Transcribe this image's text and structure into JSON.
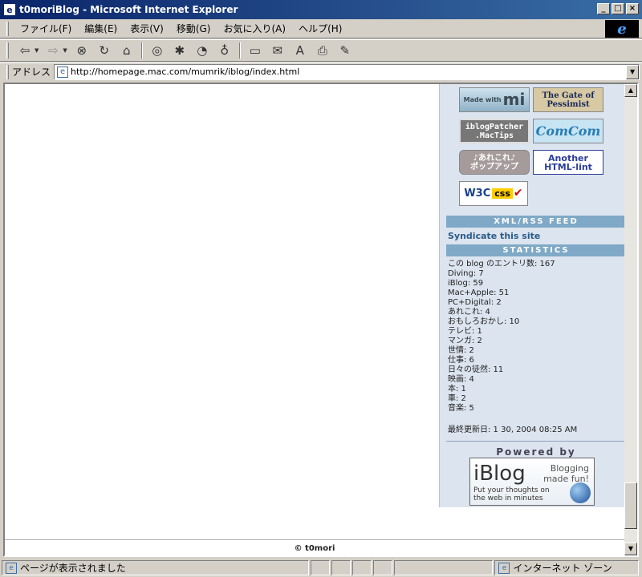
{
  "window": {
    "title": "t0moriBlog - Microsoft Internet Explorer",
    "app_icon": "ie-page-icon",
    "controls": {
      "minimize": "_",
      "maximize": "□",
      "close": "×"
    }
  },
  "menu": {
    "items": [
      "ファイル(F)",
      "編集(E)",
      "表示(V)",
      "移動(G)",
      "お気に入り(A)",
      "ヘルプ(H)"
    ]
  },
  "toolbar": {
    "icons": [
      "back-icon",
      "forward-icon",
      "stop-icon",
      "refresh-icon",
      "home-icon",
      "search-icon",
      "favorites-icon",
      "history-icon",
      "channels-icon",
      "fullscreen-icon",
      "mail-icon",
      "font-icon",
      "print-icon",
      "edit-icon"
    ]
  },
  "address": {
    "label": "アドレス",
    "url": "http://homepage.mac.com/mumrik/iblog/index.html"
  },
  "sidebar": {
    "badges": {
      "mi": "mi",
      "mi_caption": "Made with",
      "pessimist": "The Gate of Pessimist",
      "iblogpatcher_line1": "iblogPatcher",
      "iblogpatcher_line2": ".MacTips",
      "comcom": "ComCom",
      "popup_line1": "♪あれこれ♪",
      "popup_line2": "ポップアップ",
      "htmllint_line1": "Another",
      "htmllint_line2": "HTML-lint",
      "w3c": "W3C",
      "css": "css"
    },
    "xml_header": "XML/RSS FEED",
    "syndicate": "Syndicate this site",
    "stats_header": "STATISTICS",
    "stats": [
      "この blog のエントリ数: 167",
      "Diving: 7",
      "iBlog: 59",
      "Mac+Apple: 51",
      "PC+Digital: 2",
      "あれこれ: 4",
      "おもしろおかし: 10",
      "テレビ: 1",
      "マンガ: 2",
      "世情: 2",
      "仕事: 6",
      "日々の徒然: 11",
      "映画: 4",
      "本: 1",
      "車: 2",
      "音楽: 5"
    ],
    "last_updated": "最終更新日: 1 30, 2004 08:25 AM",
    "powered_by": "Powered by",
    "iblog": {
      "brand": "iBlog",
      "tagline_line1": "Blogging",
      "tagline_line2": "made fun!",
      "sub_line1": "Put your thoughts on",
      "sub_line2": "the web in minutes"
    }
  },
  "footer": {
    "copyright": "© t0mori"
  },
  "status": {
    "text": "ページが表示されました",
    "zone": "インターネット ゾーン"
  }
}
